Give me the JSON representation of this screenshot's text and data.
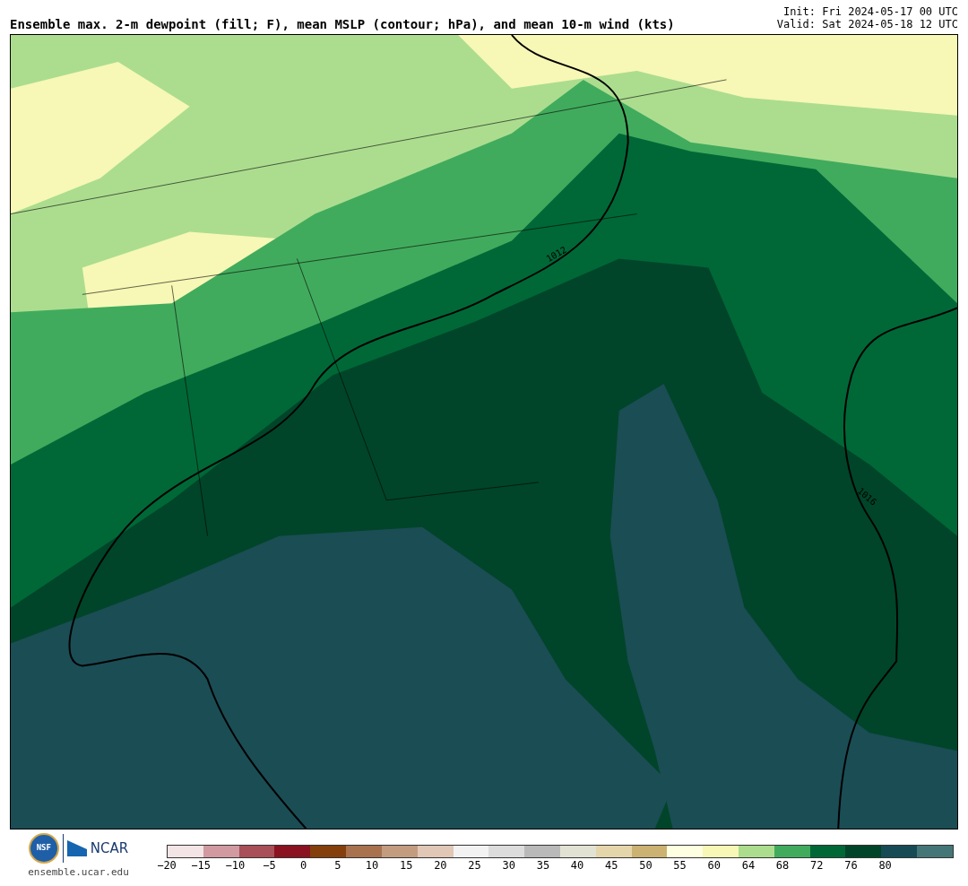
{
  "header": {
    "title": "Ensemble max. 2-m dewpoint (fill; F), mean MSLP (contour; hPa), and mean 10-m wind (kts)",
    "init": "Init: Fri 2024-05-17 00 UTC",
    "valid": "Valid: Sat 2024-05-18 12 UTC"
  },
  "map": {
    "contour_labels": [
      "1012",
      "1016"
    ]
  },
  "footer": {
    "logo_left": "NSF",
    "logo_right": "NCAR",
    "url": "ensemble.ucar.edu"
  },
  "colorbar": {
    "segments": [
      {
        "color": "#f3e4e6"
      },
      {
        "color": "#d09aa0"
      },
      {
        "color": "#a94f57"
      },
      {
        "color": "#8b1220"
      },
      {
        "color": "#843f0c"
      },
      {
        "color": "#a8724f"
      },
      {
        "color": "#c39c80"
      },
      {
        "color": "#e0c7b6"
      },
      {
        "color": "#f2f2f2"
      },
      {
        "color": "#dcdcdc"
      },
      {
        "color": "#b9b9b9"
      },
      {
        "color": "#e2e2d4"
      },
      {
        "color": "#e5d5ab"
      },
      {
        "color": "#cbb272"
      },
      {
        "color": "#fefee0"
      },
      {
        "color": "#f7f7b6"
      },
      {
        "color": "#acdd8f"
      },
      {
        "color": "#41ab5d"
      },
      {
        "color": "#006837"
      },
      {
        "color": "#004529"
      },
      {
        "color": "#164b55"
      },
      {
        "color": "#457677"
      }
    ],
    "ticks": [
      "−20",
      "−15",
      "−10",
      "−5",
      "0",
      "5",
      "10",
      "15",
      "20",
      "25",
      "30",
      "35",
      "40",
      "45",
      "50",
      "55",
      "60",
      "64",
      "68",
      "72",
      "76",
      "80"
    ]
  }
}
